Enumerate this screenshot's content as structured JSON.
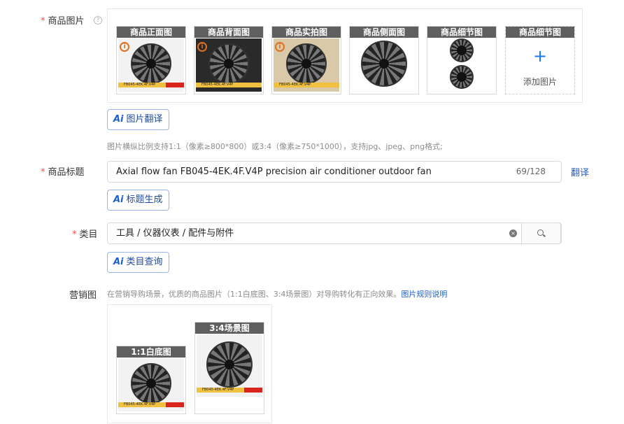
{
  "product_images": {
    "label": "商品图片",
    "help": "?",
    "slots": [
      {
        "caption": "商品正面图",
        "has_alert": true,
        "alert": "i",
        "band_text": "FB045-4EK.4F.V4P"
      },
      {
        "caption": "商品背面图",
        "has_alert": true,
        "alert": "i",
        "band_text": "FB045-4EK.4F.V4P"
      },
      {
        "caption": "商品实拍图",
        "has_alert": true,
        "alert": "i",
        "band_text": "FB045-4EK.4F.V4P"
      },
      {
        "caption": "商品侧面图",
        "has_alert": false,
        "alert": "",
        "band_text": ""
      },
      {
        "caption": "商品细节图",
        "has_alert": false,
        "alert": "",
        "band_text": ""
      }
    ],
    "add_slot": {
      "caption": "商品细节图",
      "plus": "+",
      "label": "添加图片"
    },
    "ai_translate": {
      "ai": "Ai",
      "label": "图片翻译"
    },
    "hint": "图片横纵比例支持1:1（像素≥800*800）或3:4（像素≥750*1000），支持jpg、jpeg、png格式;"
  },
  "product_title": {
    "label": "商品标题",
    "value": "Axial flow fan FB045-4EK.4F.V4P precision air conditioner outdoor fan",
    "counter": "69/128",
    "translate_link": "翻译",
    "ai_generate": {
      "ai": "Ai",
      "label": "标题生成"
    }
  },
  "category": {
    "label": "类目",
    "value": "工具 / 仪器仪表 / 配件与附件",
    "clear_icon": "×",
    "ai_query": {
      "ai": "Ai",
      "label": "类目查询"
    }
  },
  "marketing": {
    "label": "营销图",
    "desc": "在营销导购场景，优质的商品图片（1:1白底图、3:4场景图）对导购转化有正向效果。",
    "rule_link": "图片规则说明",
    "images": [
      {
        "caption": "1:1白底图",
        "band_text": "FB045-4EK.4F.V4P"
      },
      {
        "caption": "3:4场景图",
        "band_text": "FB045-4EK.4F.V4P"
      }
    ]
  },
  "colors": {
    "accent": "#1677ff",
    "required": "#ff4d4f",
    "caption_bg": "#5f5f5f"
  }
}
